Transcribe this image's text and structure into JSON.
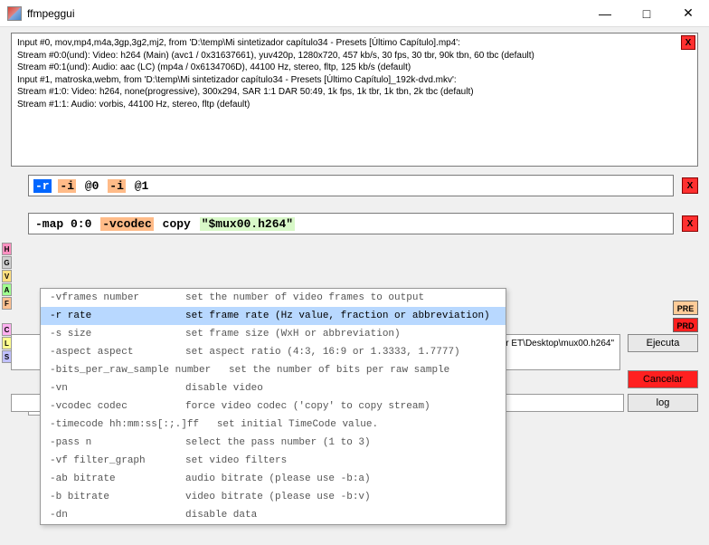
{
  "window": {
    "title": "ffmpeggui"
  },
  "info": {
    "line1": "Input #0, mov,mp4,m4a,3gp,3g2,mj2, from 'D:\\temp\\Mi sintetizador capítulo34 - Presets [Último Capítulo].mp4':",
    "line2": "    Stream #0:0(und): Video: h264 (Main) (avc1 / 0x31637661), yuv420p, 1280x720, 457 kb/s, 30 fps, 30 tbr, 90k tbn, 60 tbc (default)",
    "line3": "    Stream #0:1(und): Audio: aac (LC) (mp4a / 0x6134706D), 44100 Hz, stereo, fltp, 125 kb/s (default)",
    "line4": "Input #1, matroska,webm, from 'D:\\temp\\Mi sintetizador capítulo34 - Presets [Último Capítulo]_192k-dvd.mkv':",
    "line5": "    Stream #1:0: Video: h264, none(progressive), 300x294, SAR 1:1 DAR 50:49, 1k fps, 1k tbr, 1k tbn, 2k tbc (default)",
    "line6": "    Stream #1:1: Audio: vorbis, 44100 Hz, stereo, fltp (default)"
  },
  "cmd1": {
    "t1": "-r",
    "t2": "-i",
    "t3": "@0",
    "t4": "-i",
    "t5": "@1"
  },
  "cmd2": {
    "t1": "-map 0:0",
    "t2": "-vcodec",
    "t3": "copy",
    "t4": "\"$mux00.h264\""
  },
  "left": [
    "H",
    "G",
    "V",
    "A",
    "F",
    "C",
    "L",
    "S"
  ],
  "right": {
    "pre": "PRE",
    "prd": "PRD"
  },
  "dropdown": [
    {
      "opt": "-vframes number",
      "desc": "set the number of video frames to output"
    },
    {
      "opt": "-r rate",
      "desc": "set frame rate (Hz value, fraction or abbreviation)"
    },
    {
      "opt": "-s size",
      "desc": "set frame size (WxH or abbreviation)"
    },
    {
      "opt": "-aspect aspect",
      "desc": "set aspect ratio (4:3, 16:9 or 1.3333, 1.7777)"
    },
    {
      "opt": "-bits_per_raw_sample number",
      "desc": "set the number of bits per raw sample"
    },
    {
      "opt": "-vn",
      "desc": "disable video"
    },
    {
      "opt": "-vcodec codec",
      "desc": "force video codec ('copy' to copy stream)"
    },
    {
      "opt": "-timecode hh:mm:ss[:;.]ff",
      "desc": "set initial TimeCode value."
    },
    {
      "opt": "-pass n",
      "desc": "select the pass number (1 to 3)"
    },
    {
      "opt": "-vf filter_graph",
      "desc": "set video filters"
    },
    {
      "opt": "-ab bitrate",
      "desc": "audio bitrate (please use -b:a)"
    },
    {
      "opt": "-b bitrate",
      "desc": "video bitrate (please use -b:v)"
    },
    {
      "opt": "-dn",
      "desc": "disable data"
    }
  ],
  "dropdown_selected": 1,
  "pathtext": "4\" -i \"D:\\temp\\Mi sintetizador ET\\Desktop\\mux00.h264\"",
  "buttons": {
    "execute": "Ejecuta",
    "cancel": "Cancelar",
    "log": "log"
  },
  "x": "X"
}
